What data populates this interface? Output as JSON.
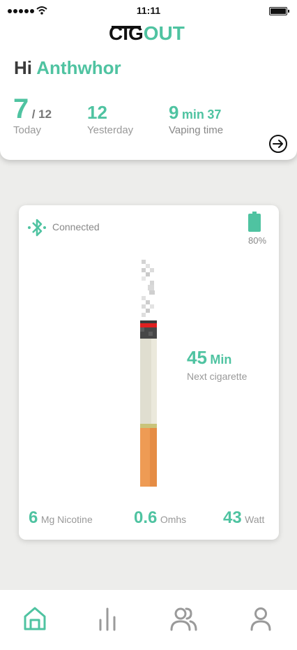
{
  "status_bar": {
    "time": "11:11"
  },
  "app": {
    "logo_dark": "CIG",
    "logo_green": "OUT",
    "accent_color": "#4fc3a1"
  },
  "greeting": {
    "hi": "Hi",
    "name": "Anthwhor"
  },
  "stats": {
    "today_value": "7",
    "today_goal": "/ 12",
    "today_label": "Today",
    "yesterday_value": "12",
    "yesterday_label": "Yesterday",
    "vaping_minutes": "9",
    "vaping_min_unit": "min",
    "vaping_seconds": "37",
    "vaping_label": "Vaping time"
  },
  "device": {
    "connection_status": "Connected",
    "battery_percent": "80%",
    "battery_level": 0.8,
    "next_cigarette_value": "45",
    "next_cigarette_unit": "Min",
    "next_cigarette_label": "Next cigarette",
    "nicotine_value": "6",
    "nicotine_unit": "Mg Nicotine",
    "resistance_value": "0.6",
    "resistance_unit": "Omhs",
    "power_value": "43",
    "power_unit": "Watt"
  },
  "icons": {
    "arrow": "arrow-right-circle-icon",
    "bluetooth": "bluetooth-icon",
    "battery": "battery-icon",
    "nav": [
      "home-icon",
      "stats-icon",
      "community-icon",
      "profile-icon"
    ]
  }
}
